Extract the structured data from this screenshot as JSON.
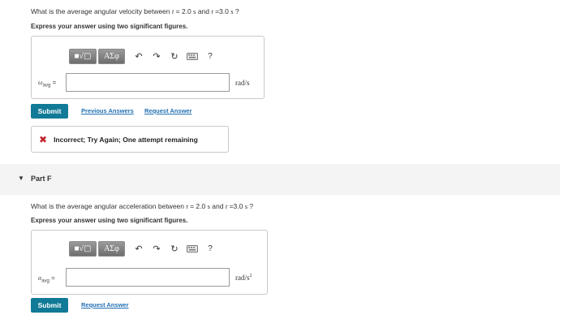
{
  "part_e": {
    "question_prefix": "What is the average angular velocity between ",
    "t_symbol": "t",
    "t1_text": " = 2.0 ",
    "unit_s": "s",
    "and_text": " and ",
    "t2_text": " =3.0 ",
    "question_suffix": " ?",
    "instruction": "Express your answer using two significant figures.",
    "variable_symbol": "ω",
    "variable_subscript": "avg",
    "variable_equals": " =",
    "input_value": "",
    "unit": "rad/s",
    "submit_label": "Submit",
    "previous_answers_label": "Previous Answers",
    "request_answer_label": "Request Answer",
    "feedback_icon": "✖",
    "feedback_text": "Incorrect; Try Again; One attempt remaining"
  },
  "toolbar": {
    "templates_label": "■√▢",
    "symbols_label": "ΑΣφ",
    "undo_icon": "↶",
    "redo_icon": "↷",
    "reset_icon": "↻",
    "keyboard_icon": "keyboard-icon",
    "help_label": "?"
  },
  "part_f": {
    "caret": "▼",
    "title": "Part F",
    "question_prefix": "What is the average angular acceleration between ",
    "t_symbol": "t",
    "t1_text": " = 2.0 ",
    "unit_s": "s",
    "and_text": " and ",
    "t2_text": " =3.0 ",
    "question_suffix": " ?",
    "instruction": "Express your answer using two significant figures.",
    "variable_symbol": "α",
    "variable_subscript": "avg",
    "variable_equals": " =",
    "input_value": "",
    "unit_base": "rad/s",
    "unit_exp": "2",
    "submit_label": "Submit",
    "request_answer_label": "Request Answer"
  },
  "colors": {
    "submit": "#117a97",
    "link": "#1f6fb2",
    "error": "#c0232b",
    "band": "#f4f4f4"
  }
}
